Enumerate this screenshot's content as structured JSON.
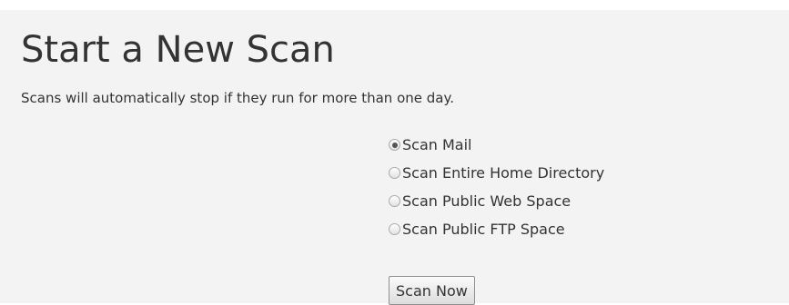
{
  "page": {
    "title": "Start a New Scan",
    "notice": "Scans will automatically stop if they run for more than one day."
  },
  "scan_options": [
    {
      "label": "Scan Mail",
      "checked": true
    },
    {
      "label": "Scan Entire Home Directory",
      "checked": false
    },
    {
      "label": "Scan Public Web Space",
      "checked": false
    },
    {
      "label": "Scan Public FTP Space",
      "checked": false
    }
  ],
  "actions": {
    "scan_now_label": "Scan Now"
  },
  "colors": {
    "panel_background": "#f3f3f3",
    "text": "#333333"
  }
}
